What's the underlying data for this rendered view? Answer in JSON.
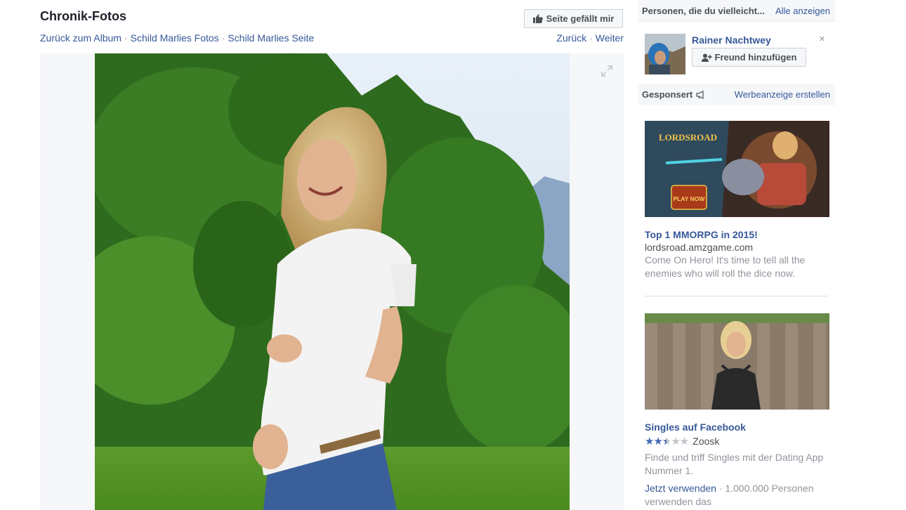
{
  "header": {
    "title": "Chronik-Fotos",
    "like_button": "Seite gefällt mir",
    "breadcrumbs": [
      "Zurück zum Album",
      "Schild Marlies Fotos",
      "Schild Marlies Seite"
    ],
    "pager": {
      "prev": "Zurück",
      "next": "Weiter"
    }
  },
  "right_column": {
    "pymk": {
      "heading": "Personen, die du vielleicht...",
      "see_all": "Alle anzeigen",
      "person_name": "Rainer Nachtwey",
      "add_friend": "Freund hinzufügen",
      "close": "×"
    },
    "sponsored": {
      "heading": "Gesponsert",
      "create_ad": "Werbeanzeige erstellen"
    },
    "ads": [
      {
        "image_text": "LORDSROAD",
        "image_button": "PLAY NOW",
        "title": "Top 1 MMORPG in 2015!",
        "domain": "lordsroad.amzgame.com",
        "body": "Come On Hero! It's time to tell all the enemies who will roll the dice now."
      },
      {
        "title": "Singles auf Facebook",
        "rating": 2.5,
        "rating_source": "Zoosk",
        "body": "Finde und triff Singles mit der Dating App Nummer 1.",
        "cta": "Jetzt verwenden",
        "cta_suffix": "· 1.000.000 Personen verwenden das"
      }
    ]
  },
  "colors": {
    "link": "#365899",
    "muted": "#90949c",
    "panel_bg": "#f6f7f9",
    "star_filled": "#4267b2"
  }
}
